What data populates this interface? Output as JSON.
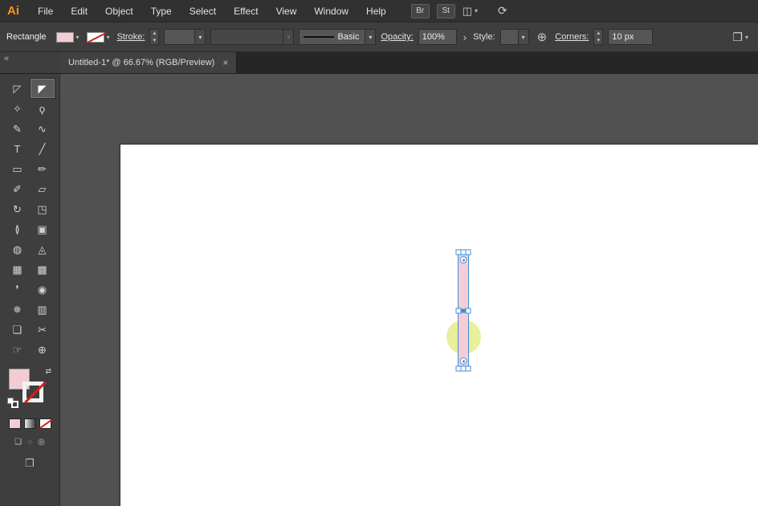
{
  "colors": {
    "logo_orange": "#f7931e",
    "fill_pink": "#f3ccd3",
    "stroke_none_red": "#d21f1f",
    "selection_blue": "#3f8fd6"
  },
  "menubar": {
    "logo": "Ai",
    "items": [
      "File",
      "Edit",
      "Object",
      "Type",
      "Select",
      "Effect",
      "View",
      "Window",
      "Help"
    ],
    "br_label": "Br",
    "st_label": "St"
  },
  "icons": {
    "workspace": "◫",
    "chevron": "▾",
    "sync": "⟳",
    "collapse": "«",
    "swap": "⇄",
    "step_up": "▴",
    "step_down": "▾",
    "flyout": "›",
    "globe": "⊕",
    "panel_menu": "❒",
    "screen_mode": "❐",
    "draw_normal": "❏",
    "draw_behind": "◌",
    "draw_inside": "◎"
  },
  "controlbar": {
    "context_label": "Rectangle",
    "stroke_label": "Stroke:",
    "stroke_weight_value": "",
    "brush_value": "",
    "stroke_style_value": "Basic",
    "opacity_label": "Opacity:",
    "opacity_value": "100%",
    "style_label": "Style:",
    "style_value": "",
    "corners_label": "Corners:",
    "corners_value": "10 px"
  },
  "tabbar": {
    "title": "Untitled-1* @ 66.67% (RGB/Preview)",
    "close": "×"
  },
  "toolbar": {
    "tools": [
      {
        "name": "selection-tool",
        "glyph": "◸"
      },
      {
        "name": "direct-selection-tool",
        "glyph": "◤",
        "selected": true
      },
      {
        "name": "magic-wand-tool",
        "glyph": "✧"
      },
      {
        "name": "lasso-tool",
        "glyph": "ϙ"
      },
      {
        "name": "pen-tool",
        "glyph": "✎"
      },
      {
        "name": "curvature-tool",
        "glyph": "∿"
      },
      {
        "name": "type-tool",
        "glyph": "T"
      },
      {
        "name": "line-segment-tool",
        "glyph": "╱"
      },
      {
        "name": "rectangle-tool",
        "glyph": "▭"
      },
      {
        "name": "paintbrush-tool",
        "glyph": "✏"
      },
      {
        "name": "pencil-tool",
        "glyph": "✐"
      },
      {
        "name": "eraser-tool",
        "glyph": "▱"
      },
      {
        "name": "rotate-tool",
        "glyph": "↻"
      },
      {
        "name": "scale-tool",
        "glyph": "◳"
      },
      {
        "name": "width-tool",
        "glyph": "≬"
      },
      {
        "name": "free-transform-tool",
        "glyph": "▣"
      },
      {
        "name": "shape-builder-tool",
        "glyph": "◍"
      },
      {
        "name": "perspective-grid-tool",
        "glyph": "◬"
      },
      {
        "name": "mesh-tool",
        "glyph": "▦"
      },
      {
        "name": "gradient-tool",
        "glyph": "▩"
      },
      {
        "name": "eyedropper-tool",
        "glyph": "❜"
      },
      {
        "name": "blend-tool",
        "glyph": "◉"
      },
      {
        "name": "symbol-sprayer-tool",
        "glyph": "✵"
      },
      {
        "name": "column-graph-tool",
        "glyph": "▥"
      },
      {
        "name": "artboard-tool",
        "glyph": "❏"
      },
      {
        "name": "slice-tool",
        "glyph": "✂"
      },
      {
        "name": "hand-tool",
        "glyph": "☞"
      },
      {
        "name": "zoom-tool",
        "glyph": "⊕"
      }
    ]
  },
  "canvas": {
    "artboard": {
      "background": "#ffffff"
    },
    "shapes": {
      "circle": {
        "fill": "#e9ef9a"
      },
      "rectangle": {
        "fill": "#f5cdd6",
        "selection_color": "#3f8fd6"
      }
    }
  }
}
